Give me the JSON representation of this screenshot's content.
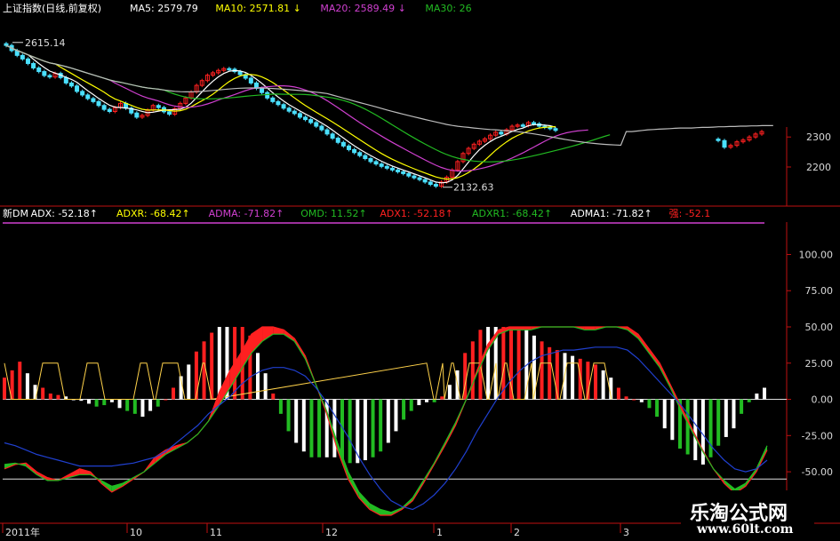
{
  "title": "上证指数(日线,前复权)",
  "colors": {
    "up": "#ff2020",
    "down": "#4ae0ff",
    "white": "#ffffff",
    "yellow": "#ffff00",
    "magenta": "#d040d0",
    "green": "#22bb22",
    "axis": "#c01010",
    "blue": "#2040d0",
    "ref": "#ffffff",
    "indicatorLine": "#ffd24a"
  },
  "legend_price": [
    {
      "label": "MA5: 2579.79",
      "color": "#ffffff"
    },
    {
      "label": "MA10: 2571.81 ↓",
      "color": "#ffff00"
    },
    {
      "label": "MA20: 2589.49 ↓",
      "color": "#d040d0"
    },
    {
      "label": "MA30: 26",
      "color": "#22bb22"
    }
  ],
  "legend_ind": [
    {
      "label": "新DM",
      "color": "#ffffff"
    },
    {
      "label": "ADX: -52.18↑",
      "color": "#ffffff"
    },
    {
      "label": "ADXR: -68.42↑",
      "color": "#ffff00"
    },
    {
      "label": "ADMA: -71.82↑",
      "color": "#d040d0"
    },
    {
      "label": "OMD: 11.52↑",
      "color": "#22bb22"
    },
    {
      "label": "ADX1: -52.18↑",
      "color": "#ff2020"
    },
    {
      "label": "ADXR1: -68.42↑",
      "color": "#22bb22"
    },
    {
      "label": "ADMA1: -71.82↑",
      "color": "#ffffff"
    },
    {
      "label": "强: -52.1",
      "color": "#ff2020"
    }
  ],
  "watermark": {
    "name": "乐淘公式网",
    "url": "www.60lt.com"
  },
  "chart_data": [
    {
      "type": "candlestick",
      "title": "上证指数(日线,前复权)",
      "x_ticks": [
        "2011年",
        "10",
        "11",
        "12",
        "1",
        "2",
        "3"
      ],
      "y_ticks": [
        2300,
        2200
      ],
      "ylim": [
        2120,
        2650
      ],
      "annotations": [
        {
          "label": "2615.14",
          "value": 2615.14
        },
        {
          "label": "2132.63",
          "value": 2132.63
        }
      ],
      "close": [
        2605,
        2588,
        2572,
        2560,
        2545,
        2530,
        2518,
        2505,
        2500,
        2512,
        2498,
        2480,
        2470,
        2452,
        2440,
        2428,
        2418,
        2405,
        2392,
        2385,
        2398,
        2412,
        2396,
        2380,
        2366,
        2372,
        2390,
        2405,
        2398,
        2384,
        2376,
        2394,
        2412,
        2430,
        2450,
        2472,
        2488,
        2506,
        2514,
        2522,
        2528,
        2526,
        2518,
        2508,
        2496,
        2480,
        2462,
        2448,
        2430,
        2418,
        2408,
        2396,
        2386,
        2378,
        2366,
        2358,
        2348,
        2336,
        2324,
        2310,
        2296,
        2282,
        2270,
        2258,
        2248,
        2238,
        2228,
        2218,
        2210,
        2202,
        2196,
        2190,
        2184,
        2178,
        2170,
        2164,
        2158,
        2150,
        2142,
        2136,
        2150,
        2166,
        2190,
        2218,
        2245,
        2262,
        2276,
        2286,
        2294,
        2306,
        2316,
        2310,
        2324,
        2336,
        2340,
        2338,
        2348,
        2344,
        2336,
        2332,
        2328,
        2322
      ],
      "close_after_gap": [
        2288,
        2266,
        2272,
        2284,
        2290,
        2300,
        2310,
        2318
      ],
      "ma5_label": "MA5",
      "ma10_label": "MA10",
      "ma20_label": "MA20",
      "ma30_label": "MA30"
    },
    {
      "type": "bar",
      "title": "新DM",
      "y_ticks": [
        100.0,
        75.0,
        50.0,
        25.0,
        0.0,
        -25.0,
        -50.0
      ],
      "ylim": [
        -80,
        115
      ],
      "reference_lines": [
        50,
        0,
        -55
      ],
      "omd": [
        15,
        20,
        26,
        18,
        10,
        8,
        4,
        3,
        2,
        0,
        -1,
        -3,
        -5,
        -4,
        -2,
        -6,
        -8,
        -10,
        -12,
        -8,
        -5,
        0,
        8,
        16,
        24,
        33,
        40,
        46,
        50,
        50,
        50,
        50,
        44,
        32,
        18,
        4,
        -10,
        -22,
        -30,
        -36,
        -40,
        -40,
        -40,
        -40,
        -42,
        -44,
        -44,
        -42,
        -40,
        -36,
        -30,
        -22,
        -14,
        -8,
        -4,
        -2,
        -2,
        2,
        10,
        20,
        32,
        40,
        48,
        50,
        50,
        50,
        50,
        50,
        48,
        44,
        40,
        36,
        34,
        32,
        30,
        28,
        26,
        24,
        20,
        15,
        8,
        2,
        0,
        -2,
        -6,
        -12,
        -20,
        -28,
        -34,
        -38,
        -42,
        -45,
        -40,
        -32,
        -26,
        -20,
        -10,
        -2,
        4,
        8
      ],
      "adx1": [
        -48,
        -45,
        -44,
        -50,
        -54,
        -56,
        -52,
        -48,
        -50,
        -58,
        -64,
        -60,
        -55,
        -50,
        -40,
        -35,
        -32,
        -30,
        -24,
        -15,
        5,
        20,
        32,
        45,
        50,
        50,
        48,
        42,
        30,
        10,
        -10,
        -35,
        -55,
        -68,
        -76,
        -80,
        -80,
        -76,
        -70,
        -58,
        -45,
        -32,
        -18,
        0,
        20,
        38,
        48,
        50,
        50,
        50,
        50,
        50,
        50,
        50,
        50,
        50,
        50,
        50,
        50,
        45,
        35,
        25,
        10,
        -5,
        -20,
        -35,
        -48,
        -58,
        -65,
        -60,
        -50,
        -35
      ],
      "adxr1": [
        -45,
        -44,
        -46,
        -52,
        -56,
        -56,
        -54,
        -52,
        -52,
        -56,
        -60,
        -58,
        -54,
        -50,
        -44,
        -38,
        -34,
        -30,
        -24,
        -15,
        -4,
        8,
        20,
        32,
        40,
        45,
        45,
        40,
        28,
        10,
        -8,
        -30,
        -50,
        -64,
        -72,
        -76,
        -78,
        -75,
        -68,
        -56,
        -44,
        -30,
        -16,
        0,
        18,
        34,
        45,
        48,
        48,
        48,
        50,
        50,
        50,
        50,
        48,
        48,
        50,
        50,
        48,
        42,
        32,
        22,
        8,
        -8,
        -22,
        -36,
        -48,
        -56,
        -62,
        -58,
        -48,
        -32
      ],
      "adma": [
        -30,
        -32,
        -35,
        -38,
        -40,
        -42,
        -44,
        -46,
        -46,
        -46,
        -46,
        -45,
        -44,
        -42,
        -40,
        -36,
        -30,
        -24,
        -18,
        -10,
        -4,
        2,
        10,
        16,
        20,
        22,
        22,
        20,
        16,
        8,
        -2,
        -14,
        -26,
        -40,
        -52,
        -62,
        -70,
        -74,
        -76,
        -72,
        -66,
        -58,
        -48,
        -36,
        -22,
        -10,
        2,
        12,
        20,
        26,
        30,
        32,
        34,
        34,
        35,
        36,
        36,
        36,
        34,
        28,
        20,
        12,
        4,
        -4,
        -14,
        -24,
        -34,
        -42,
        -48,
        -50,
        -48,
        -42
      ]
    }
  ]
}
